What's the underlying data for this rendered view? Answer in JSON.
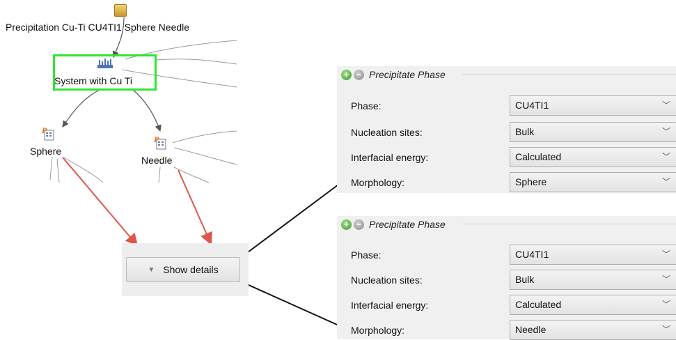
{
  "tree": {
    "root": {
      "label": "Precipitation Cu-Ti CU4TI1 Sphere Needle",
      "icon": "database-icon"
    },
    "system": {
      "label": "System with Cu Ti",
      "icon": "system-grid-icon"
    },
    "children": [
      {
        "label": "Sphere",
        "icon": "precipitation-calc-icon"
      },
      {
        "label": "Needle",
        "icon": "precipitation-calc-icon"
      }
    ]
  },
  "show_details": {
    "label": "Show details",
    "icon": "triangle-down-icon"
  },
  "panels": [
    {
      "title": "Precipitate Phase",
      "rows": [
        {
          "label": "Phase:",
          "value": "CU4TI1"
        },
        {
          "label": "Nucleation sites:",
          "value": "Bulk"
        },
        {
          "label": "Interfacial energy:",
          "value": "Calculated"
        },
        {
          "label": "Morphology:",
          "value": "Sphere"
        }
      ]
    },
    {
      "title": "Precipitate Phase",
      "rows": [
        {
          "label": "Phase:",
          "value": "CU4TI1"
        },
        {
          "label": "Nucleation sites:",
          "value": "Bulk"
        },
        {
          "label": "Interfacial energy:",
          "value": "Calculated"
        },
        {
          "label": "Morphology:",
          "value": "Needle"
        }
      ]
    }
  ],
  "colors": {
    "selection": "#2ee62e",
    "arrow": "#e0554a",
    "connector": "#999999"
  }
}
